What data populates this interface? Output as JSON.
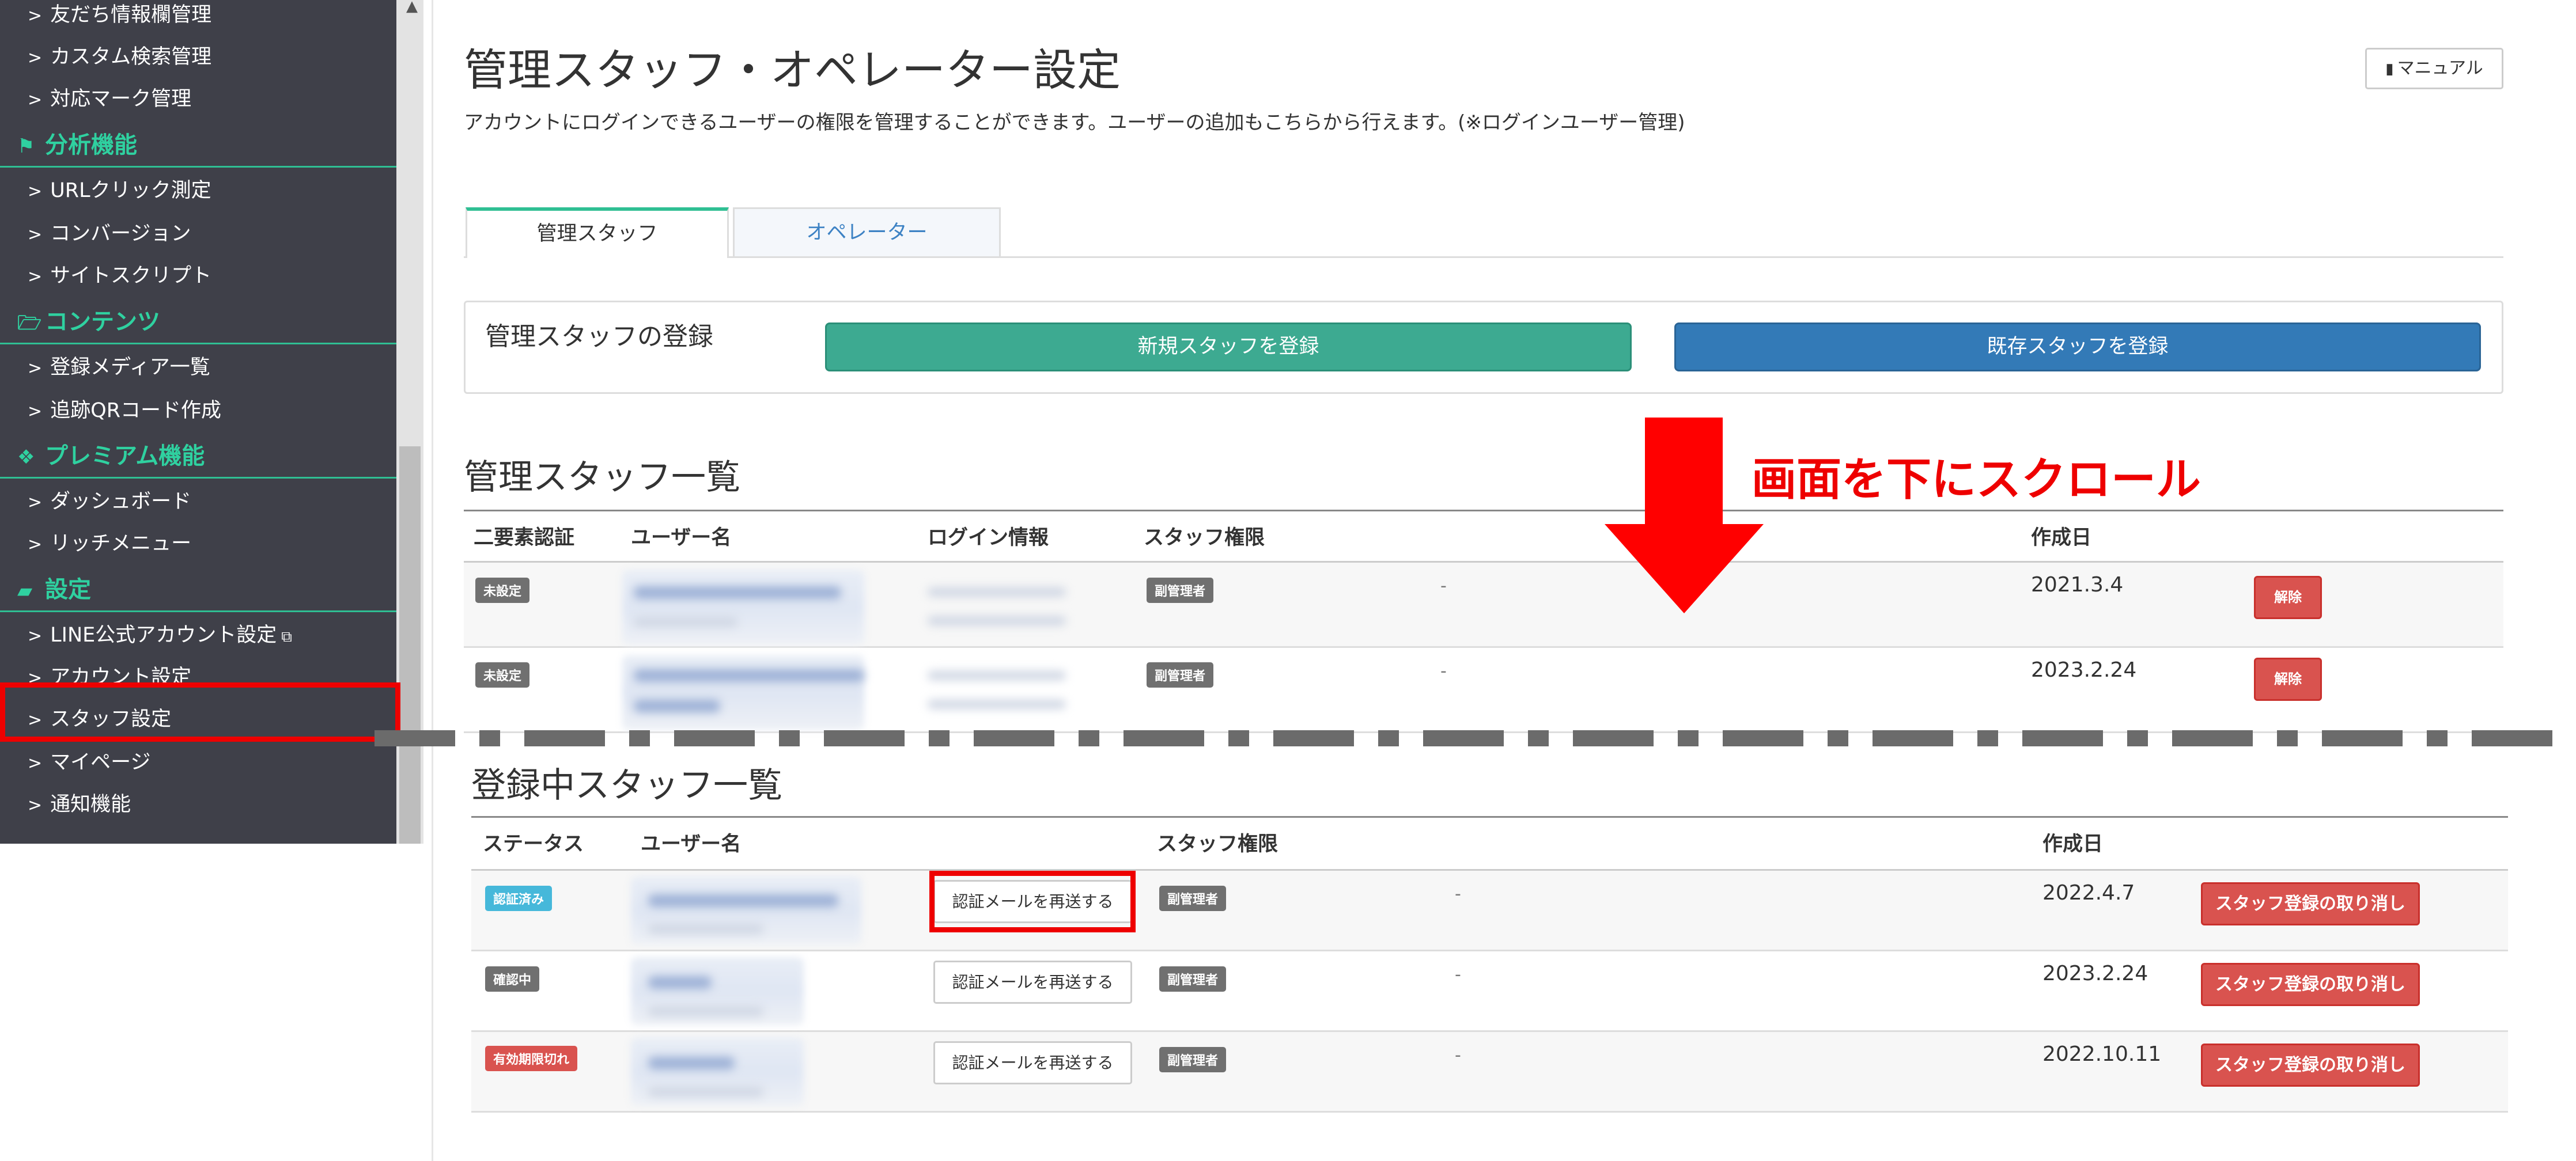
{
  "sidebar": {
    "items": [
      {
        "label": "友だち情報欄管理",
        "type": "item"
      },
      {
        "label": "カスタム検索管理",
        "type": "item"
      },
      {
        "label": "対応マーク管理",
        "type": "item"
      },
      {
        "label": "分析機能",
        "type": "category",
        "icon": "flag-icon"
      },
      {
        "label": "URLクリック測定",
        "type": "item"
      },
      {
        "label": "コンバージョン",
        "type": "item"
      },
      {
        "label": "サイトスクリプト",
        "type": "item"
      },
      {
        "label": "コンテンツ",
        "type": "category",
        "icon": "folder-open-icon"
      },
      {
        "label": "登録メディア一覧",
        "type": "item"
      },
      {
        "label": "追跡QRコード作成",
        "type": "item"
      },
      {
        "label": "プレミアム機能",
        "type": "category",
        "icon": "gift-icon"
      },
      {
        "label": "ダッシュボード",
        "type": "item"
      },
      {
        "label": "リッチメニュー",
        "type": "item"
      },
      {
        "label": "設定",
        "type": "category",
        "icon": "comment-icon"
      },
      {
        "label": "LINE公式アカウント設定",
        "type": "item",
        "external": true
      },
      {
        "label": "アカウント設定",
        "type": "item"
      },
      {
        "label": "スタッフ設定",
        "type": "item",
        "active": true
      },
      {
        "label": "マイページ",
        "type": "item"
      },
      {
        "label": "通知機能",
        "type": "item"
      }
    ]
  },
  "header": {
    "title": "管理スタッフ・オペレーター設定",
    "description": "アカウントにログインできるユーザーの権限を管理することができます。ユーザーの追加もこちらから行えます。(※ログインユーザー管理)",
    "manual_label": "マニュアル"
  },
  "tabs": [
    {
      "label": "管理スタッフ",
      "active": true
    },
    {
      "label": "オペレーター",
      "active": false
    }
  ],
  "register": {
    "label": "管理スタッフの登録",
    "new_button": "新規スタッフを登録",
    "existing_button": "既存スタッフを登録"
  },
  "annotation": {
    "scroll_text": "画面を下にスクロール"
  },
  "staff_list": {
    "title": "管理スタッフ一覧",
    "columns": [
      "二要素認証",
      "ユーザー名",
      "ログイン情報",
      "スタッフ権限",
      "作成日"
    ],
    "rows": [
      {
        "two_factor": "未設定",
        "role": "副管理者",
        "note": "-",
        "created": "2021.3.4",
        "delete_label": "解除"
      },
      {
        "two_factor": "未設定",
        "role": "副管理者",
        "note": "-",
        "created": "2023.2.24",
        "delete_label": "解除"
      }
    ]
  },
  "registering_list": {
    "title": "登録中スタッフ一覧",
    "columns": [
      "ステータス",
      "ユーザー名",
      "スタッフ権限",
      "作成日"
    ],
    "rows": [
      {
        "status": "認証済み",
        "status_color": "#46b8da",
        "resend_label": "認証メールを再送する",
        "role": "副管理者",
        "note": "-",
        "created": "2022.4.7",
        "cancel_label": "スタッフ登録の取り消し"
      },
      {
        "status": "確認中",
        "status_color": "#707070",
        "resend_label": "認証メールを再送する",
        "role": "副管理者",
        "note": "-",
        "created": "2023.2.24",
        "cancel_label": "スタッフ登録の取り消し"
      },
      {
        "status": "有効期限切れ",
        "status_color": "#d9534f",
        "resend_label": "認証メールを再送する",
        "role": "副管理者",
        "note": "-",
        "created": "2022.10.11",
        "cancel_label": "スタッフ登録の取り消し"
      }
    ]
  },
  "colors": {
    "sidebar_bg": "#3f4049",
    "accent_green": "#2fd1a0",
    "primary_blue": "#337ab7",
    "success_green": "#3daa91",
    "danger_red": "#d9534f",
    "highlight_red": "#ee0000"
  }
}
